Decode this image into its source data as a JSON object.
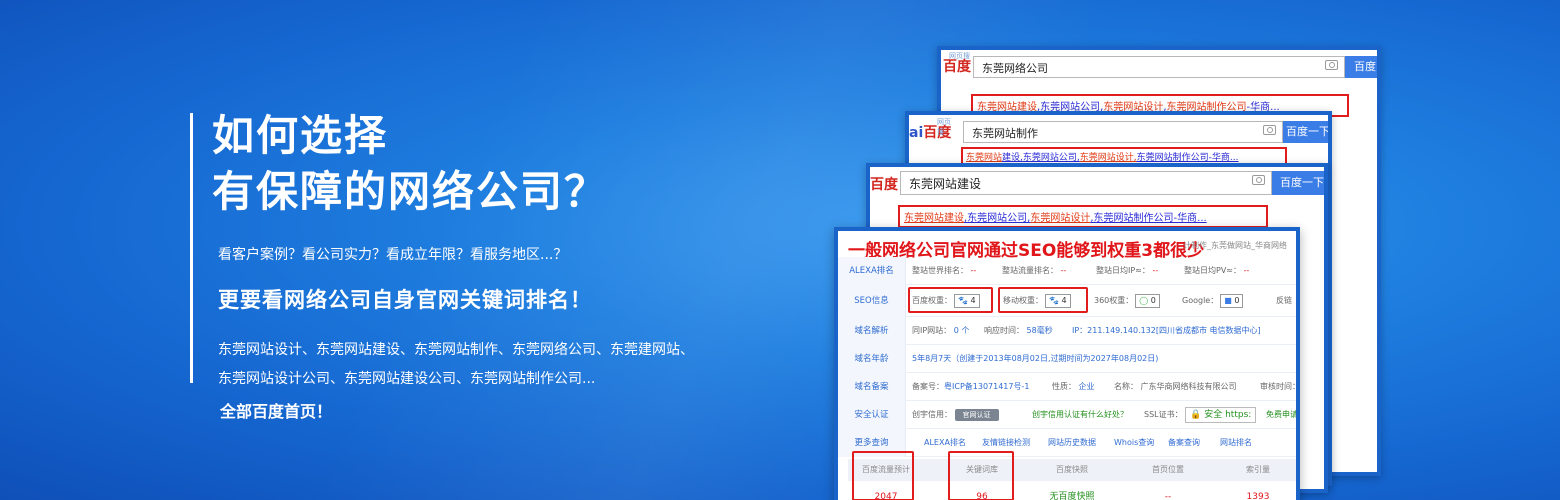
{
  "left": {
    "headline_line1": "如何选择",
    "headline_line2": "有保障的网络公司？",
    "questions": "看客户案例？看公司实力？看成立年限？看服务地区...？",
    "emphasis": "更要看网络公司自身官网关键词排名！",
    "keywords_line1": "东莞网站设计、东莞网站建设、东莞网站制作、东莞网络公司、东莞建网站、",
    "keywords_line2": "东莞网站设计公司、东莞网站建设公司、东莞网站制作公司...",
    "all_first_page": "全部百度首页！"
  },
  "windows": [
    {
      "logo": "百度",
      "logo_small": "网页搜",
      "query": "东莞网络公司",
      "button": "百度",
      "result_parts": [
        "东莞网站建设",
        ",东莞网站公司,",
        "东莞网站设计",
        ",",
        "东莞网站制作公司",
        "-华商..."
      ]
    },
    {
      "logo_prefix": "ai",
      "logo": "百度",
      "logo_small": "网页搜",
      "query": "东莞网站制作",
      "button": "百度一下",
      "result_parts": [
        "东莞网站",
        "建设,",
        "东莞网站公司,",
        "东莞网站设计,",
        "东莞网站制作公司",
        "-华商..."
      ]
    },
    {
      "logo": "百度",
      "query": "东莞网站建设",
      "button": "百度一下",
      "result_parts": [
        "东莞网站建设",
        ",东莞网站公司,",
        "东莞网站设计",
        ",东莞网站制作公司",
        "-华商..."
      ]
    }
  ],
  "seo": {
    "title": "一般网络公司官网通过SEO能够到权重3都很少",
    "title_tail": "计制作_东莞做网站_华商网络",
    "rows": {
      "alexa": {
        "label": "ALEXA排名",
        "c1": "整站世界排名：",
        "v1": "--",
        "c2": "整站流量排名：",
        "v2": "--",
        "c3": "整站日均IP≈：",
        "v3": "--",
        "c4": "整站日均PV≈：",
        "v4": "--"
      },
      "seoinfo": {
        "label": "SEO信息",
        "baidu": "百度权重：",
        "baidu_v": "4",
        "mobile": "移动权重：",
        "mobile_v": "4",
        "s360": "360权重：",
        "s360_v": "0",
        "google": "Google：",
        "google_v": "0",
        "fan": "反链"
      },
      "domain": {
        "label": "域名解析",
        "ip_label": "同IP网站：",
        "ip_v": "0 个",
        "resp_label": "响应时间：",
        "resp_v": "58毫秒",
        "ip": "IP：211.149.140.132[四川省成都市 电信数据中心]"
      },
      "age": {
        "label": "域名年龄",
        "text": "5年8月7天（创建于2013年08月02日,过期时间为2027年08月02日)"
      },
      "icp": {
        "label": "域名备案",
        "no_label": "备案号：",
        "no": "粤ICP备13071417号-1",
        "nature_label": "性质：",
        "nature": "企业",
        "name_label": "名称：",
        "name": "广东华商网络科技有限公司",
        "review": "审核时间："
      },
      "cert": {
        "label": "安全认证",
        "credit_label": "创宇信用：",
        "seal": "官网认证",
        "credit_q": "创宇信用认证有什么好处？",
        "ssl_label": "SSL证书：",
        "ssl": "🔒 安全 https:",
        "free": "免费申请"
      },
      "more": {
        "label": "更多查询",
        "links": [
          "ALEXA排名",
          "友情链接检测",
          "网站历史数据",
          "Whois查询",
          "备案查询",
          "网站排名"
        ]
      }
    },
    "table": {
      "headers": [
        "百度流量预计",
        "关键词库",
        "百度快照",
        "首页位置",
        "索引量"
      ],
      "values": [
        "2047",
        "96",
        "无百度快照",
        "--",
        "1393"
      ]
    }
  }
}
